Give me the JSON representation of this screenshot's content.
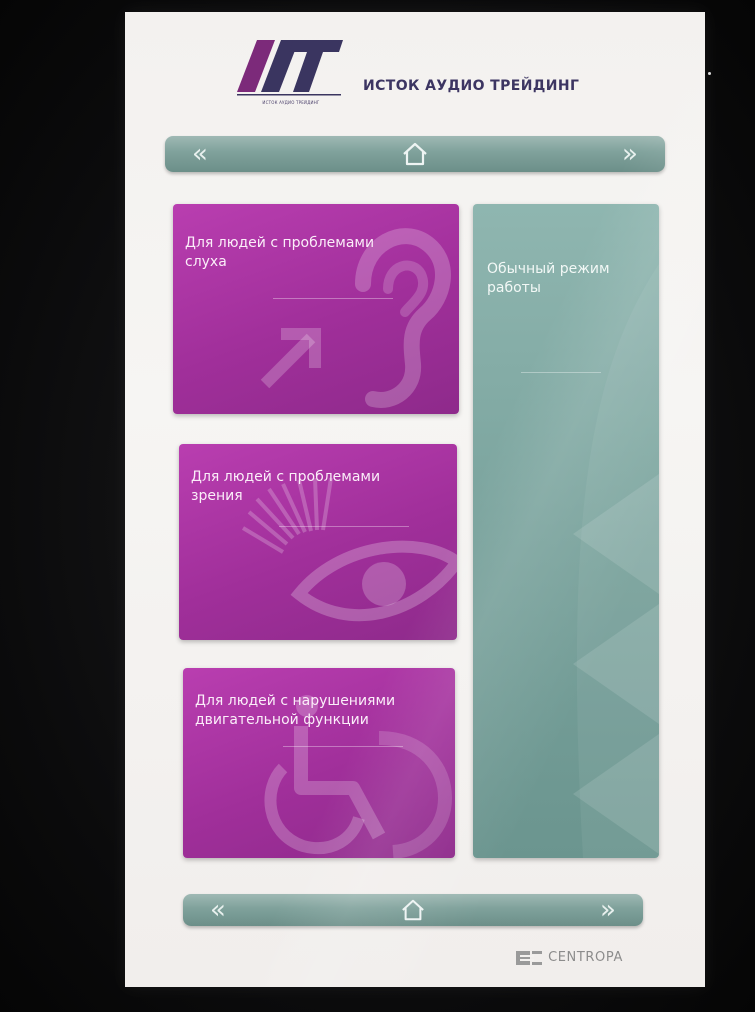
{
  "header": {
    "logo_text": "АТ",
    "logo_subtitle": "ИСТОК АУДИО ТРЕЙДИНГ",
    "brand_title": "ИСТОК АУДИО ТРЕЙДИНГ"
  },
  "nav_top": {
    "prev_label": "«",
    "next_label": "»",
    "home_icon": "home-icon"
  },
  "tiles": {
    "hearing": {
      "label": "Для людей с проблемами слуха",
      "icon": "ear-icon"
    },
    "vision": {
      "label": "Для людей с проблемами зрения",
      "icon": "eye-icon"
    },
    "mobility": {
      "label": "Для людей с нарушениями двигательной функции",
      "icon": "wheelchair-icon"
    },
    "normal": {
      "label": "Обычный режим работы"
    }
  },
  "nav_bottom": {
    "prev_label": "«",
    "next_label": "»",
    "home_icon": "home-icon"
  },
  "footer": {
    "brand": "CENTROPA"
  },
  "colors": {
    "magenta": "#a8329f",
    "teal": "#7ea59f",
    "navbar": "#7fa19b",
    "brand_purple": "#3c3562"
  }
}
